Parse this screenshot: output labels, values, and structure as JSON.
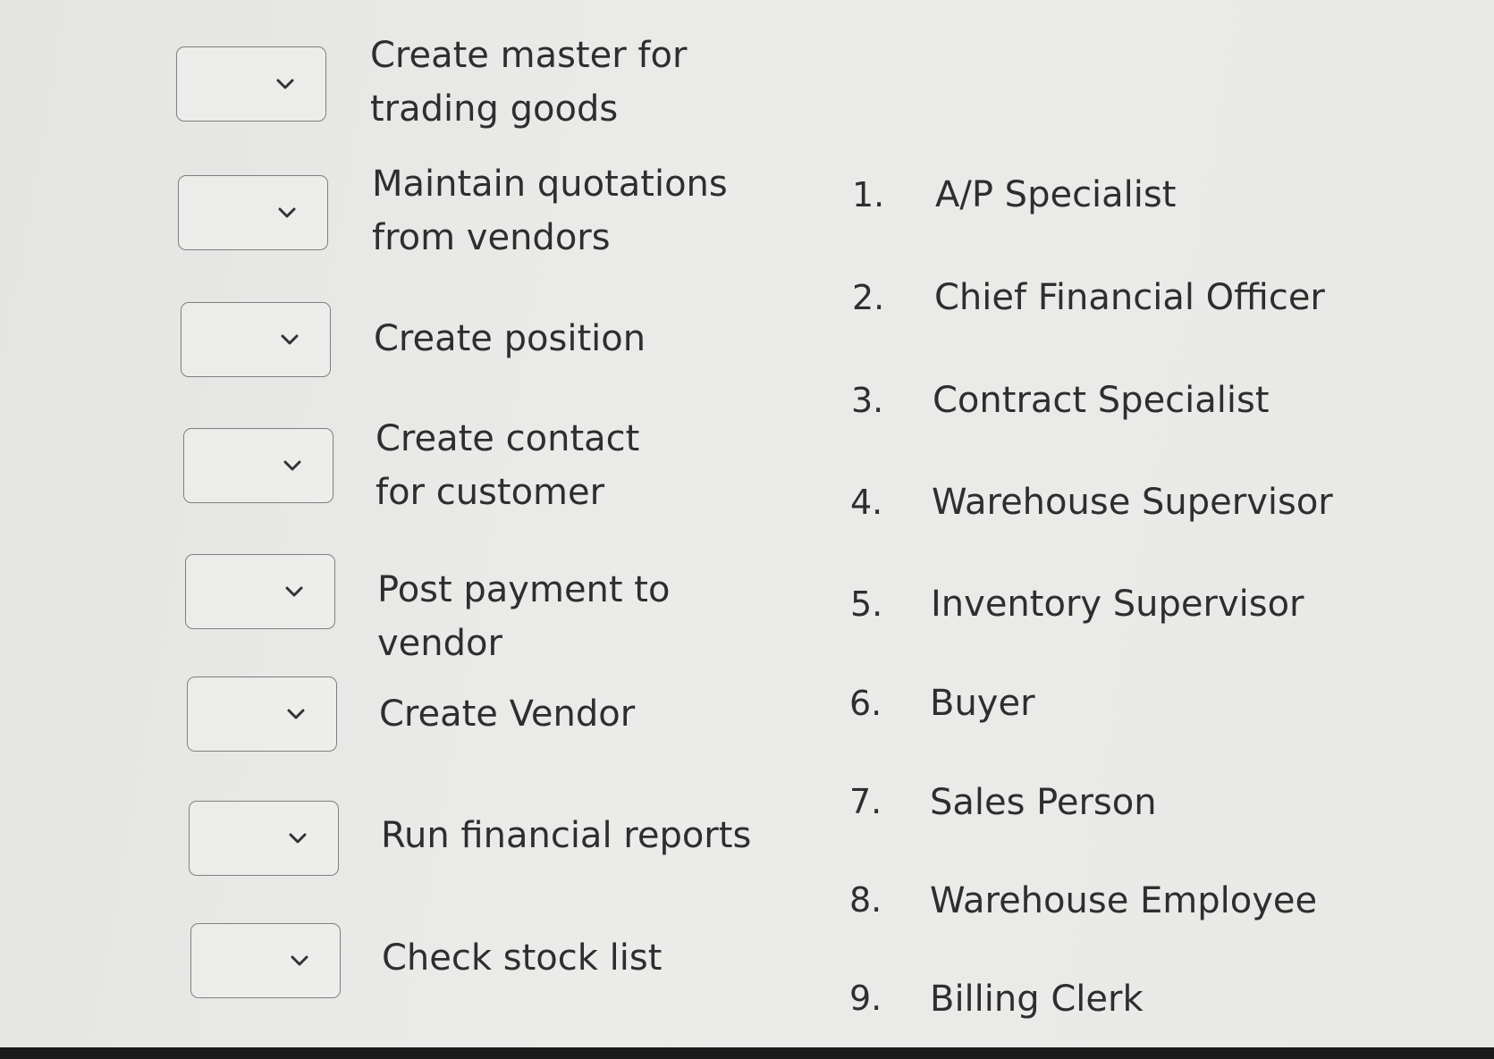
{
  "tasks": [
    {
      "label": "Create master for trading goods"
    },
    {
      "label": "Maintain quotations from vendors"
    },
    {
      "label": "Create position"
    },
    {
      "label": "Create contact for customer"
    },
    {
      "label": "Post payment to vendor"
    },
    {
      "label": "Create Vendor"
    },
    {
      "label": "Run financial reports"
    },
    {
      "label": "Check stock list"
    }
  ],
  "select_icon": "chevron-down-icon",
  "options": [
    {
      "num": "1.",
      "label": "A/P Specialist"
    },
    {
      "num": "2.",
      "label": "Chief Financial Officer"
    },
    {
      "num": "3.",
      "label": "Contract Specialist"
    },
    {
      "num": "4.",
      "label": "Warehouse Supervisor"
    },
    {
      "num": "5.",
      "label": "Inventory Supervisor"
    },
    {
      "num": "6.",
      "label": "Buyer"
    },
    {
      "num": "7.",
      "label": "Sales Person"
    },
    {
      "num": "8.",
      "label": "Warehouse Employee"
    },
    {
      "num": "9.",
      "label": "Billing Clerk"
    }
  ]
}
